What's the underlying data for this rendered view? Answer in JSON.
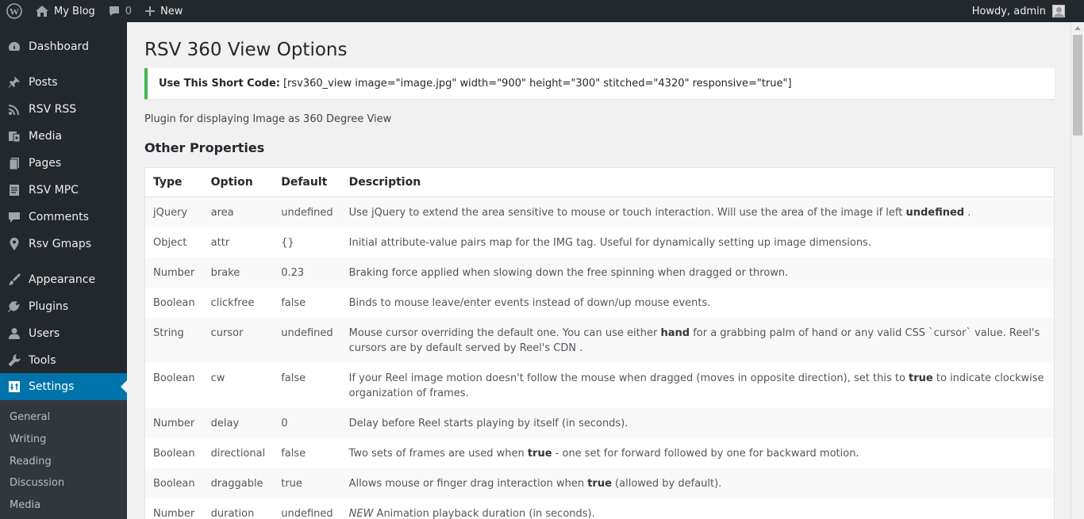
{
  "adminbar": {
    "site_name": "My Blog",
    "comments_count": "0",
    "new_label": "New",
    "howdy": "Howdy, admin"
  },
  "sidebar": {
    "items": [
      {
        "label": "Dashboard",
        "icon": "dashboard-icon"
      },
      {
        "label": "Posts",
        "icon": "pushpin-icon"
      },
      {
        "label": "RSV RSS",
        "icon": "rss-icon"
      },
      {
        "label": "Media",
        "icon": "media-icon"
      },
      {
        "label": "Pages",
        "icon": "pages-icon"
      },
      {
        "label": "RSV MPC",
        "icon": "document-icon"
      },
      {
        "label": "Comments",
        "icon": "comment-icon"
      },
      {
        "label": "Rsv Gmaps",
        "icon": "location-pin-icon"
      },
      {
        "label": "Appearance",
        "icon": "paintbrush-icon"
      },
      {
        "label": "Plugins",
        "icon": "plug-icon"
      },
      {
        "label": "Users",
        "icon": "user-icon"
      },
      {
        "label": "Tools",
        "icon": "wrench-icon"
      },
      {
        "label": "Settings",
        "icon": "settings-sliders-icon",
        "current": true
      }
    ],
    "submenu": [
      "General",
      "Writing",
      "Reading",
      "Discussion",
      "Media"
    ]
  },
  "page": {
    "title": "RSV 360 View Options",
    "notice_label": "Use This Short Code:",
    "notice_code": "[rsv360_view image=\"image.jpg\" width=\"900\" height=\"300\" stitched=\"4320\" responsive=\"true\"]",
    "description": "Plugin for displaying Image as 360 Degree View",
    "section_title": "Other Properties"
  },
  "table": {
    "headers": [
      "Type",
      "Option",
      "Default",
      "Description"
    ],
    "rows": [
      {
        "type": "jQuery",
        "option": "area",
        "default": "undefined",
        "desc": [
          "Use jQuery to extend the area sensitive to mouse or touch interaction. Will use the area of the image if left ",
          {
            "b": "undefined"
          },
          " ."
        ]
      },
      {
        "type": "Object",
        "option": "attr",
        "default": "{}",
        "desc": [
          "Initial attribute-value pairs map for the IMG tag. Useful for dynamically setting up image dimensions."
        ]
      },
      {
        "type": "Number",
        "option": "brake",
        "default": "0.23",
        "desc": [
          "Braking force applied when slowing down the free spinning when dragged or thrown."
        ]
      },
      {
        "type": "Boolean",
        "option": "clickfree",
        "default": "false",
        "desc": [
          "Binds to mouse leave/enter events instead of down/up mouse events."
        ]
      },
      {
        "type": "String",
        "option": "cursor",
        "default": "undefined",
        "desc": [
          "Mouse cursor overriding the default one. You can use either ",
          {
            "b": "hand"
          },
          " for a grabbing palm of hand or any valid CSS `cursor` value. Reel's cursors are by default served by Reel's CDN ."
        ]
      },
      {
        "type": "Boolean",
        "option": "cw",
        "default": "false",
        "desc": [
          "If your Reel image motion doesn't follow the mouse when dragged (moves in opposite direction), set this to ",
          {
            "b": "true"
          },
          " to indicate clockwise organization of frames."
        ]
      },
      {
        "type": "Number",
        "option": "delay",
        "default": "0",
        "desc": [
          "Delay before Reel starts playing by itself (in seconds)."
        ]
      },
      {
        "type": "Boolean",
        "option": "directional",
        "default": "false",
        "desc": [
          "Two sets of frames are used when ",
          {
            "b": "true"
          },
          " - one set for forward followed by one for backward motion."
        ]
      },
      {
        "type": "Boolean",
        "option": "draggable",
        "default": "true",
        "desc": [
          "Allows mouse or finger drag interaction when ",
          {
            "b": "true"
          },
          " (allowed by default)."
        ]
      },
      {
        "type": "Number",
        "option": "duration",
        "default": "undefined",
        "desc": [
          {
            "i": "NEW"
          },
          " Animation playback duration (in seconds)."
        ]
      }
    ]
  },
  "colors": {
    "adminbar_bg": "#23282d",
    "sidebar_bg": "#23282d",
    "submenu_bg": "#32373c",
    "accent": "#0073aa",
    "notice_border": "#46b450"
  }
}
